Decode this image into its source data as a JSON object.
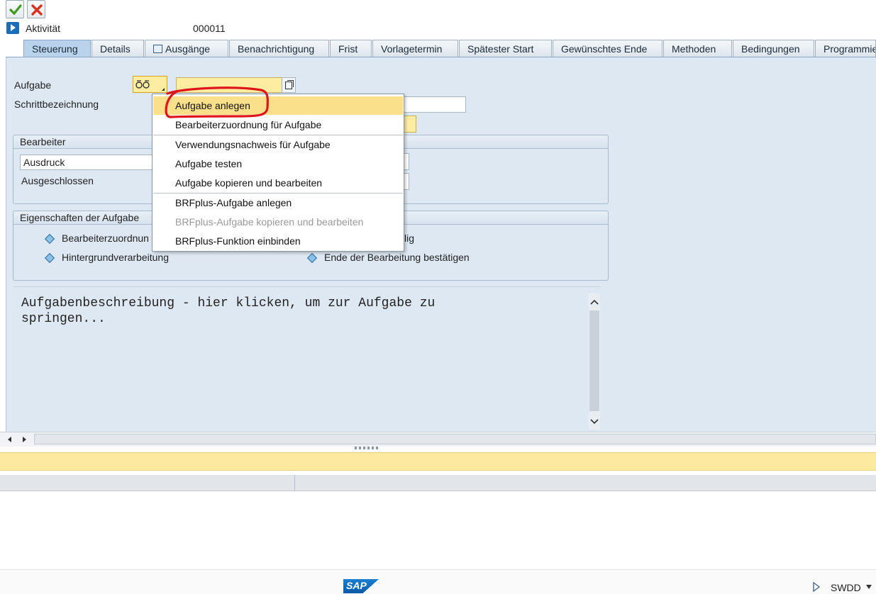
{
  "toolbar": {
    "confirm_icon": "check-icon",
    "cancel_icon": "cancel-icon"
  },
  "header": {
    "label": "Aktivität",
    "value": "000011"
  },
  "tabs": [
    {
      "label": "Steuerung",
      "active": true
    },
    {
      "label": "Details"
    },
    {
      "label": "Ausgänge"
    },
    {
      "label": "Benachrichtigung"
    },
    {
      "label": "Frist"
    },
    {
      "label": "Vorlagetermin"
    },
    {
      "label": "Spätester Start"
    },
    {
      "label": "Gewünschtes Ende"
    },
    {
      "label": "Methoden"
    },
    {
      "label": "Bedingungen"
    },
    {
      "label": "Programmie"
    }
  ],
  "form": {
    "task_label": "Aufgabe",
    "step_label": "Schrittbezeichnung"
  },
  "agent_group": {
    "title": "Bearbeiter",
    "expression_value": "Ausdruck",
    "excluded_label": "Ausgeschlossen"
  },
  "props_group": {
    "title": "Eigenschaften der Aufgabe",
    "items": [
      "Bearbeiterzuordnun",
      "Hintergrundverarbeitung",
      "lig",
      "Ende der Bearbeitung bestätigen"
    ]
  },
  "description": "Aufgabenbeschreibung - hier klicken, um zur Aufgabe zu\nspringen...",
  "menu": {
    "items": [
      {
        "label": "Aufgabe anlegen",
        "selected": true
      },
      {
        "label": "Bearbeiterzuordnung für Aufgabe"
      },
      {
        "label": "Verwendungsnachweis für Aufgabe"
      },
      {
        "label": "Aufgabe testen"
      },
      {
        "label": "Aufgabe kopieren und bearbeiten"
      },
      {
        "label": "BRFplus-Aufgabe anlegen"
      },
      {
        "label": "BRFplus-Aufgabe kopieren und bearbeiten",
        "disabled": true
      },
      {
        "label": "BRFplus-Funktion einbinden"
      }
    ]
  },
  "footer": {
    "system": "SWDD",
    "logo": "SAP"
  },
  "colors": {
    "annotation_red": "#e0151b",
    "menu_highlight": "#fbe08b",
    "status_yellow": "#fde9a0"
  }
}
